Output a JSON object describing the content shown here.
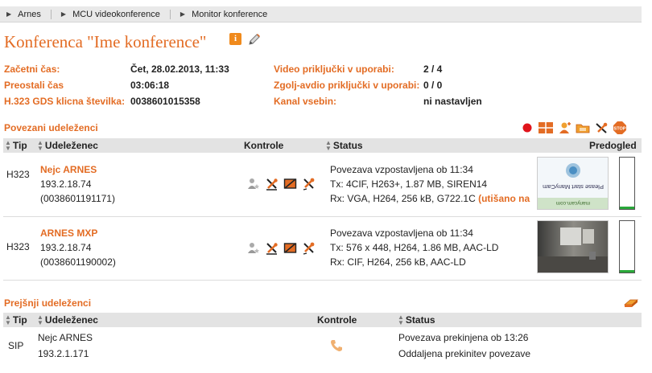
{
  "breadcrumb": [
    "Arnes",
    "MCU videokonference",
    "Monitor konference"
  ],
  "title": "Konferenca \"Ime konference\"",
  "details": {
    "left": [
      {
        "label": "Začetni čas:",
        "value": "Čet, 28.02.2013, 11:33"
      },
      {
        "label": "Preostali čas",
        "value": "03:06:18"
      },
      {
        "label": "H.323 GDS klicna številka:",
        "value": "0038601015358"
      }
    ],
    "right": [
      {
        "label": "Video priključki v uporabi:",
        "value": "2 / 4"
      },
      {
        "label": "Zgolj-avdio priključki v uporabi:",
        "value": "0 / 0"
      },
      {
        "label": "Kanal vsebin:",
        "value": "ni nastavljen"
      }
    ]
  },
  "connected": {
    "title": "Povezani udeleženci",
    "toolbar_icons": [
      "record-icon",
      "layout-grid-icon",
      "add-participant-icon",
      "folder-icon",
      "mute-all-icon",
      "stop-icon"
    ],
    "columns": {
      "type": "Tip",
      "participant": "Udeleženec",
      "controls": "Kontrole",
      "status": "Status",
      "preview": "Predogled"
    },
    "rows": [
      {
        "type": "H323",
        "name": "Nejc ARNES",
        "ip": "193.2.18.74",
        "number": "(0038601191171)",
        "status": [
          "Povezava vzpostavljena ob 11:34",
          "Tx: 4CIF, H263+, 1.87 MB, SIREN14",
          "Rx: VGA, H264, 256 kB, G722.1C"
        ],
        "status_note": "(utišano na",
        "preview_text": "Please start ManyCam",
        "preview_site": "manycam.com",
        "audio_level": 0.04
      },
      {
        "type": "H323",
        "name": "ARNES MXP",
        "ip": "193.2.18.74",
        "number": "(0038601190002)",
        "status": [
          "Povezava vzpostavljena ob 11:34",
          "Tx: 576 x 448, H264, 1.86 MB, AAC-LD",
          "Rx: CIF, H264, 256 kB, AAC-LD"
        ],
        "status_note": "",
        "preview_text": "",
        "preview_site": "",
        "audio_level": 0.05
      }
    ]
  },
  "previous": {
    "title": "Prejšnji udeleženci",
    "columns": {
      "type": "Tip",
      "participant": "Udeleženec",
      "controls": "Kontrole",
      "status": "Status"
    },
    "rows": [
      {
        "type": "SIP",
        "name": "Nejc ARNES",
        "ip": "193.2.1.171",
        "status": [
          "Povezava prekinjena ob 13:26",
          "Oddaljena prekinitev povezave"
        ]
      }
    ]
  },
  "colors": {
    "accent": "#e36c24",
    "header_bg": "#e3e3e3",
    "level": "#2aa83a"
  }
}
